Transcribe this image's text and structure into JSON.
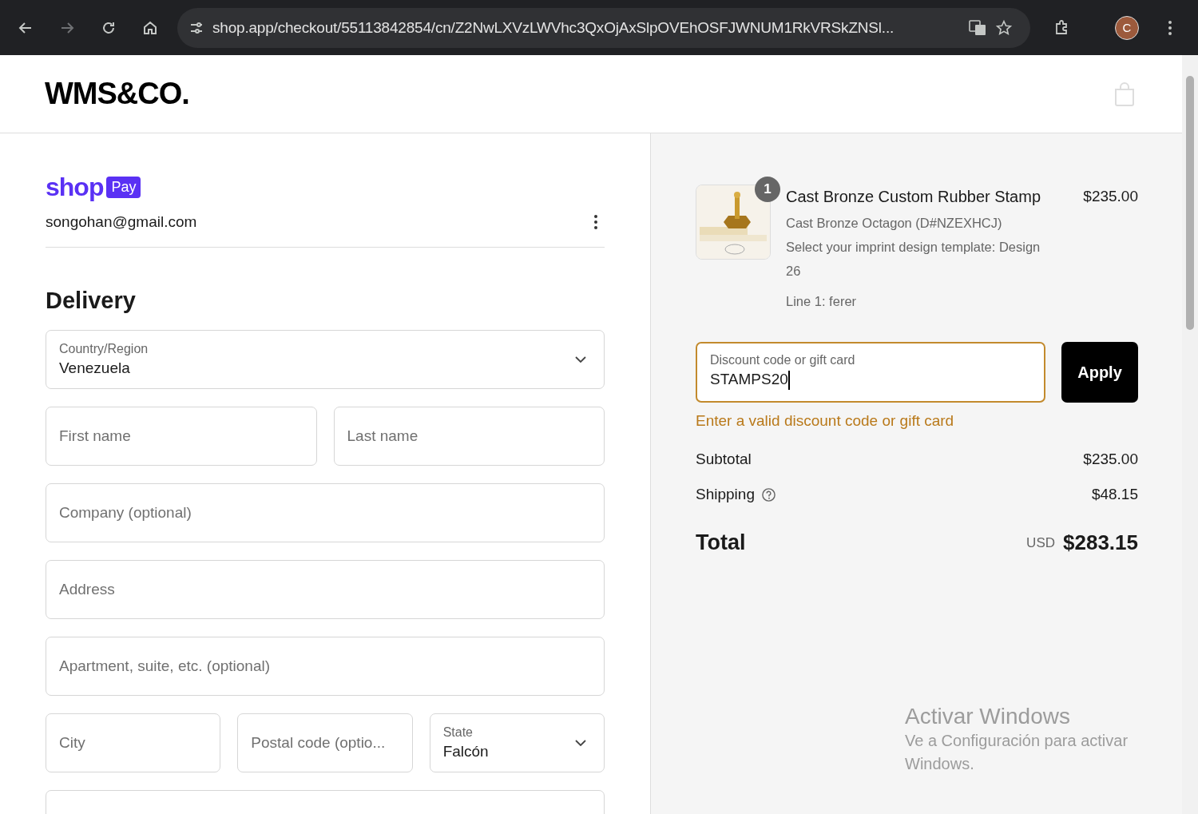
{
  "browser": {
    "url": "shop.app/checkout/55113842854/cn/Z2NwLXVzLWVhc3QxOjAxSlpOVEhOSFJWNUM1RkVRSkZNSl...",
    "profile_initial": "C"
  },
  "store": {
    "logo": "WMS&CO."
  },
  "shop_pay": {
    "brand": "shop",
    "badge": "Pay",
    "email": "songohan@gmail.com"
  },
  "delivery": {
    "heading": "Delivery",
    "rows": [
      [
        {
          "kind": "select",
          "label": "Country/Region",
          "value": "Venezuela"
        }
      ],
      [
        {
          "kind": "text",
          "placeholder": "First name"
        },
        {
          "kind": "text",
          "placeholder": "Last name"
        }
      ],
      [
        {
          "kind": "text",
          "placeholder": "Company (optional)"
        }
      ],
      [
        {
          "kind": "text",
          "placeholder": "Address"
        }
      ],
      [
        {
          "kind": "text",
          "placeholder": "Apartment, suite, etc. (optional)"
        }
      ],
      [
        {
          "kind": "text",
          "placeholder": "City"
        },
        {
          "kind": "text",
          "placeholder": "Postal code (optio..."
        },
        {
          "kind": "select",
          "label": "State",
          "value": "Falcón"
        }
      ]
    ]
  },
  "item": {
    "quantity": "1",
    "title": "Cast Bronze Custom Rubber Stamp",
    "price": "$235.00",
    "details": [
      "Cast Bronze Octagon (D#NZEXHCJ)",
      "Select your imprint design template: Design 26",
      "Line 1: ferer"
    ]
  },
  "discount": {
    "label": "Discount code or gift card",
    "value": "STAMPS20",
    "invalid": true,
    "error": "Enter a valid discount code or gift card",
    "button": "Apply"
  },
  "totals": {
    "subtotal_label": "Subtotal",
    "subtotal": "$235.00",
    "shipping_label": "Shipping",
    "shipping": "$48.15",
    "total_label": "Total",
    "currency": "USD",
    "total": "$283.15"
  },
  "windows_notice": {
    "title": "Activar Windows",
    "text": "Ve a Configuración para activar Windows."
  }
}
